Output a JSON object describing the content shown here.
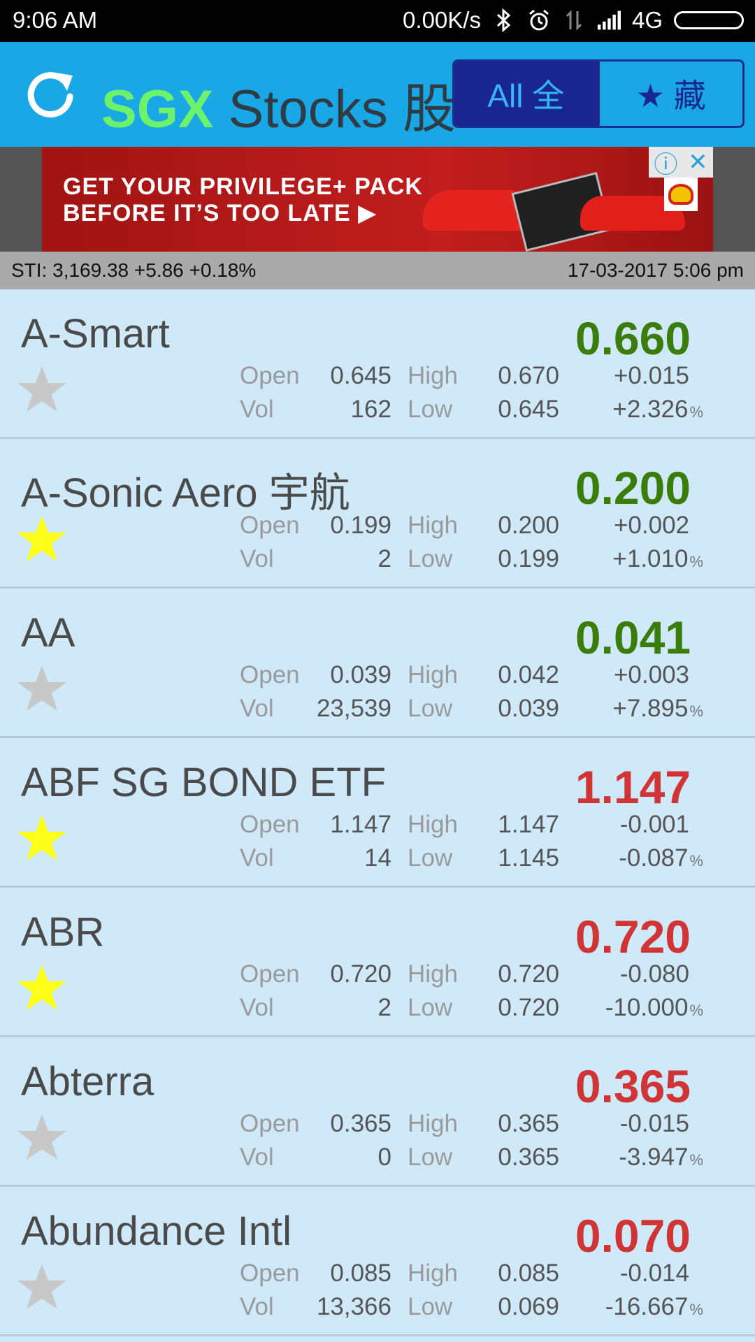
{
  "statusbar": {
    "time": "9:06  AM",
    "speed": "0.00K/s",
    "network": "4G"
  },
  "header": {
    "title_part1": "SGX",
    "title_part2": "Stocks 股",
    "tab_all": "All 全",
    "tab_fav": "★ 藏"
  },
  "ad": {
    "text": "GET YOUR PRIVILEGE+ PACK\nBEFORE IT’S TOO LATE ▶",
    "info": "ⓘ",
    "close": "✕"
  },
  "index": {
    "sti": "STI:  3,169.38  +5.86  +0.18%",
    "datetime": "17-03-2017 5:06 pm"
  },
  "labels": {
    "open": "Open",
    "vol": "Vol",
    "high": "High",
    "low": "Low",
    "pct_unit": "%"
  },
  "colors": {
    "up": "#3a7d0a",
    "down": "#d03434",
    "star_on": "#ffff1a",
    "star_off": "#c8c8c8"
  },
  "stocks": [
    {
      "name": "A-Smart",
      "price": "0.660",
      "dir": "up",
      "fav": false,
      "open": "0.645",
      "vol": "162",
      "high": "0.670",
      "low": "0.645",
      "change": "+0.015",
      "pct": "+2.326"
    },
    {
      "name": "A-Sonic Aero 宇航",
      "price": "0.200",
      "dir": "up",
      "fav": true,
      "open": "0.199",
      "vol": "2",
      "high": "0.200",
      "low": "0.199",
      "change": "+0.002",
      "pct": "+1.010"
    },
    {
      "name": "AA",
      "price": "0.041",
      "dir": "up",
      "fav": false,
      "open": "0.039",
      "vol": "23,539",
      "high": "0.042",
      "low": "0.039",
      "change": "+0.003",
      "pct": "+7.895"
    },
    {
      "name": "ABF SG BOND ETF",
      "price": "1.147",
      "dir": "down",
      "fav": true,
      "open": "1.147",
      "vol": "14",
      "high": "1.147",
      "low": "1.145",
      "change": "-0.001",
      "pct": "-0.087"
    },
    {
      "name": "ABR",
      "price": "0.720",
      "dir": "down",
      "fav": true,
      "open": "0.720",
      "vol": "2",
      "high": "0.720",
      "low": "0.720",
      "change": "-0.080",
      "pct": "-10.000"
    },
    {
      "name": "Abterra",
      "price": "0.365",
      "dir": "down",
      "fav": false,
      "open": "0.365",
      "vol": "0",
      "high": "0.365",
      "low": "0.365",
      "change": "-0.015",
      "pct": "-3.947"
    },
    {
      "name": "Abundance Intl",
      "price": "0.070",
      "dir": "down",
      "fav": false,
      "open": "0.085",
      "vol": "13,366",
      "high": "0.085",
      "low": "0.069",
      "change": "-0.014",
      "pct": "-16.667"
    }
  ]
}
